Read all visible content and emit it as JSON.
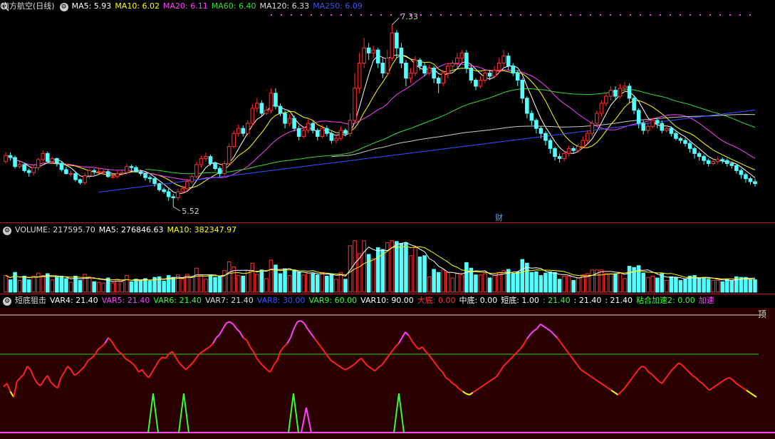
{
  "price": {
    "title": "南方航空(日线)",
    "ma": [
      {
        "label": "MA5: 5.93",
        "color": "#ffffff"
      },
      {
        "label": "MA10: 6.02",
        "color": "#ffff00"
      },
      {
        "label": "MA20: 6.11",
        "color": "#ff40ff"
      },
      {
        "label": "MA60: 6.40",
        "color": "#33dd33"
      },
      {
        "label": "MA120: 6.33",
        "color": "#dddddd"
      },
      {
        "label": "MA250: 6.09",
        "color": "#3355ff"
      }
    ],
    "high_label": "7.33",
    "low_label": "5.52",
    "marker": "财",
    "candles": [
      [
        5.97,
        6.03,
        5.95,
        6.06
      ],
      [
        6.03,
        6.01,
        5.98,
        6.06
      ],
      [
        6.01,
        5.92,
        5.9,
        6.03
      ],
      [
        5.92,
        5.94,
        5.9,
        5.97
      ],
      [
        5.94,
        5.88,
        5.86,
        5.96
      ],
      [
        5.88,
        5.86,
        5.82,
        5.9
      ],
      [
        5.86,
        5.91,
        5.83,
        5.94
      ],
      [
        5.91,
        5.99,
        5.88,
        6.01
      ],
      [
        5.99,
        6.05,
        5.97,
        6.08
      ],
      [
        6.05,
        5.97,
        5.95,
        6.07
      ],
      [
        5.97,
        6.0,
        5.95,
        6.02
      ],
      [
        6.0,
        5.95,
        5.92,
        6.01
      ],
      [
        5.95,
        5.89,
        5.87,
        5.97
      ],
      [
        5.89,
        5.85,
        5.84,
        5.92
      ],
      [
        5.85,
        5.85,
        5.82,
        5.88
      ],
      [
        5.85,
        5.79,
        5.77,
        5.87
      ],
      [
        5.79,
        5.76,
        5.74,
        5.8
      ],
      [
        5.76,
        5.83,
        5.74,
        5.86
      ],
      [
        5.83,
        5.88,
        5.8,
        5.9
      ],
      [
        5.88,
        5.87,
        5.84,
        5.9
      ],
      [
        5.87,
        5.87,
        5.85,
        5.91
      ],
      [
        5.87,
        5.87,
        5.84,
        5.89
      ],
      [
        5.87,
        5.82,
        5.81,
        5.89
      ],
      [
        5.82,
        5.82,
        5.8,
        5.85
      ],
      [
        5.82,
        5.85,
        5.8,
        5.88
      ],
      [
        5.85,
        5.86,
        5.83,
        5.89
      ],
      [
        5.86,
        5.92,
        5.84,
        5.95
      ],
      [
        5.92,
        5.91,
        5.88,
        5.94
      ],
      [
        5.91,
        5.87,
        5.86,
        5.93
      ],
      [
        5.87,
        5.85,
        5.83,
        5.89
      ],
      [
        5.85,
        5.81,
        5.78,
        5.86
      ],
      [
        5.81,
        5.8,
        5.76,
        5.83
      ],
      [
        5.8,
        5.75,
        5.72,
        5.81
      ],
      [
        5.75,
        5.69,
        5.67,
        5.76
      ],
      [
        5.69,
        5.67,
        5.65,
        5.71
      ],
      [
        5.67,
        5.62,
        5.58,
        5.7
      ],
      [
        5.62,
        5.61,
        5.52,
        5.65
      ],
      [
        5.61,
        5.67,
        5.58,
        5.7
      ],
      [
        5.67,
        5.7,
        5.65,
        5.73
      ],
      [
        5.7,
        5.77,
        5.68,
        5.8
      ],
      [
        5.77,
        5.82,
        5.75,
        5.84
      ],
      [
        5.82,
        5.94,
        5.8,
        5.97
      ],
      [
        5.94,
        6.0,
        5.91,
        6.03
      ],
      [
        6.0,
        6.02,
        5.97,
        6.06
      ],
      [
        6.02,
        5.95,
        5.93,
        6.04
      ],
      [
        5.95,
        5.9,
        5.88,
        5.97
      ],
      [
        5.9,
        5.85,
        5.82,
        5.92
      ],
      [
        5.85,
        5.95,
        5.83,
        5.98
      ],
      [
        5.95,
        6.12,
        5.93,
        6.15
      ],
      [
        6.12,
        6.25,
        6.1,
        6.28
      ],
      [
        6.25,
        6.3,
        6.22,
        6.34
      ],
      [
        6.3,
        6.25,
        6.22,
        6.33
      ],
      [
        6.25,
        6.35,
        6.23,
        6.38
      ],
      [
        6.35,
        6.5,
        6.32,
        6.54
      ],
      [
        6.5,
        6.55,
        6.46,
        6.6
      ],
      [
        6.55,
        6.45,
        6.42,
        6.58
      ],
      [
        6.45,
        6.48,
        6.43,
        6.52
      ],
      [
        6.48,
        6.65,
        6.45,
        6.7
      ],
      [
        6.65,
        6.52,
        6.49,
        6.7
      ],
      [
        6.52,
        6.45,
        6.42,
        6.55
      ],
      [
        6.45,
        6.35,
        6.3,
        6.48
      ],
      [
        6.35,
        6.4,
        6.32,
        6.44
      ],
      [
        6.4,
        6.3,
        6.27,
        6.43
      ],
      [
        6.3,
        6.22,
        6.18,
        6.33
      ],
      [
        6.22,
        6.28,
        6.2,
        6.32
      ],
      [
        6.28,
        6.35,
        6.25,
        6.39
      ],
      [
        6.35,
        6.28,
        6.25,
        6.38
      ],
      [
        6.28,
        6.22,
        6.18,
        6.3
      ],
      [
        6.22,
        6.3,
        6.2,
        6.34
      ],
      [
        6.3,
        6.25,
        6.22,
        6.33
      ],
      [
        6.25,
        6.18,
        6.15,
        6.27
      ],
      [
        6.18,
        6.2,
        6.15,
        6.24
      ],
      [
        6.2,
        6.28,
        6.18,
        6.32
      ],
      [
        6.28,
        6.25,
        6.22,
        6.3
      ],
      [
        6.25,
        6.38,
        6.22,
        6.45
      ],
      [
        6.38,
        6.7,
        6.35,
        6.85
      ],
      [
        6.7,
        6.95,
        6.65,
        7.05
      ],
      [
        6.95,
        7.1,
        6.9,
        7.2
      ],
      [
        7.1,
        7.05,
        6.98,
        7.15
      ],
      [
        7.05,
        7.08,
        7.0,
        7.12
      ],
      [
        7.08,
        6.95,
        6.9,
        7.1
      ],
      [
        6.95,
        6.85,
        6.8,
        7.0
      ],
      [
        6.85,
        7.0,
        6.82,
        7.08
      ],
      [
        7.0,
        7.25,
        6.97,
        7.33
      ],
      [
        7.25,
        7.1,
        7.0,
        7.28
      ],
      [
        7.1,
        6.95,
        6.9,
        7.15
      ],
      [
        6.95,
        6.8,
        6.72,
        6.98
      ],
      [
        6.8,
        6.85,
        6.75,
        6.9
      ],
      [
        6.85,
        6.98,
        6.82,
        7.02
      ],
      [
        6.98,
        6.92,
        6.88,
        7.0
      ],
      [
        6.92,
        6.85,
        6.82,
        6.95
      ],
      [
        6.85,
        6.9,
        6.83,
        6.93
      ],
      [
        6.9,
        6.8,
        6.75,
        6.92
      ],
      [
        6.8,
        6.75,
        6.65,
        6.82
      ],
      [
        6.75,
        6.85,
        6.72,
        6.88
      ],
      [
        6.85,
        6.92,
        6.8,
        6.95
      ],
      [
        6.92,
        6.95,
        6.88,
        6.98
      ],
      [
        6.95,
        7.0,
        6.9,
        7.05
      ],
      [
        7.0,
        7.05,
        6.95,
        7.08
      ],
      [
        7.05,
        6.9,
        6.85,
        7.08
      ],
      [
        6.9,
        6.78,
        6.75,
        6.92
      ],
      [
        6.78,
        6.72,
        6.68,
        6.8
      ],
      [
        6.72,
        6.78,
        6.7,
        6.82
      ],
      [
        6.78,
        6.85,
        6.75,
        6.88
      ],
      [
        6.85,
        6.82,
        6.78,
        6.88
      ],
      [
        6.82,
        6.88,
        6.8,
        6.92
      ],
      [
        6.88,
        6.95,
        6.85,
        7.0
      ],
      [
        6.95,
        7.02,
        6.9,
        7.08
      ],
      [
        7.02,
        6.92,
        6.88,
        7.05
      ],
      [
        6.92,
        6.85,
        6.82,
        6.95
      ],
      [
        6.85,
        6.78,
        6.72,
        6.88
      ],
      [
        6.78,
        6.6,
        6.55,
        6.8
      ],
      [
        6.6,
        6.45,
        6.4,
        6.62
      ],
      [
        6.45,
        6.38,
        6.33,
        6.48
      ],
      [
        6.38,
        6.3,
        6.25,
        6.4
      ],
      [
        6.3,
        6.25,
        6.2,
        6.32
      ],
      [
        6.25,
        6.18,
        6.13,
        6.27
      ],
      [
        6.18,
        6.1,
        6.05,
        6.2
      ],
      [
        6.1,
        6.02,
        5.98,
        6.12
      ],
      [
        6.02,
        6.0,
        5.96,
        6.05
      ],
      [
        6.0,
        6.05,
        5.97,
        6.08
      ],
      [
        6.05,
        6.1,
        6.02,
        6.13
      ],
      [
        6.1,
        6.08,
        6.05,
        6.12
      ],
      [
        6.08,
        6.12,
        6.06,
        6.15
      ],
      [
        6.12,
        6.18,
        6.1,
        6.22
      ],
      [
        6.18,
        6.25,
        6.15,
        6.28
      ],
      [
        6.25,
        6.35,
        6.22,
        6.38
      ],
      [
        6.35,
        6.45,
        6.32,
        6.48
      ],
      [
        6.45,
        6.55,
        6.42,
        6.58
      ],
      [
        6.55,
        6.62,
        6.52,
        6.65
      ],
      [
        6.62,
        6.68,
        6.58,
        6.72
      ],
      [
        6.68,
        6.62,
        6.58,
        6.72
      ],
      [
        6.62,
        6.7,
        6.6,
        6.74
      ],
      [
        6.7,
        6.72,
        6.66,
        6.76
      ],
      [
        6.72,
        6.6,
        6.55,
        6.75
      ],
      [
        6.6,
        6.48,
        6.44,
        6.62
      ],
      [
        6.48,
        6.35,
        6.3,
        6.5
      ],
      [
        6.35,
        6.28,
        6.24,
        6.38
      ],
      [
        6.28,
        6.32,
        6.25,
        6.35
      ],
      [
        6.32,
        6.38,
        6.3,
        6.4
      ],
      [
        6.38,
        6.35,
        6.3,
        6.4
      ],
      [
        6.35,
        6.28,
        6.25,
        6.38
      ],
      [
        6.28,
        6.3,
        6.26,
        6.33
      ],
      [
        6.3,
        6.25,
        6.22,
        6.32
      ],
      [
        6.25,
        6.2,
        6.18,
        6.27
      ],
      [
        6.2,
        6.18,
        6.15,
        6.22
      ],
      [
        6.18,
        6.15,
        6.12,
        6.2
      ],
      [
        6.15,
        6.1,
        6.06,
        6.17
      ],
      [
        6.1,
        6.05,
        6.0,
        6.12
      ],
      [
        6.05,
        6.02,
        5.98,
        6.07
      ],
      [
        6.02,
        5.98,
        5.94,
        6.04
      ],
      [
        5.98,
        5.95,
        5.92,
        6.0
      ],
      [
        5.95,
        5.97,
        5.93,
        6.0
      ],
      [
        5.97,
        5.99,
        5.95,
        6.02
      ],
      [
        5.99,
        5.98,
        5.95,
        6.01
      ],
      [
        5.98,
        5.95,
        5.92,
        6.0
      ],
      [
        5.95,
        5.93,
        5.9,
        5.97
      ],
      [
        5.93,
        5.88,
        5.85,
        5.95
      ],
      [
        5.88,
        5.84,
        5.8,
        5.9
      ],
      [
        5.84,
        5.8,
        5.76,
        5.86
      ],
      [
        5.8,
        5.77,
        5.74,
        5.82
      ],
      [
        5.77,
        5.75,
        5.72,
        5.8
      ]
    ]
  },
  "volume": {
    "label": "VOLUME: 217595.70",
    "ma5": "MA5: 276846.63",
    "ma10": "MA10: 382347.97"
  },
  "indicator": {
    "name": "短底狙击",
    "vars": [
      {
        "label": "VAR4: 21.40",
        "color": "#ffffff"
      },
      {
        "label": "VAR5: 21.40",
        "color": "#ff40ff"
      },
      {
        "label": "VAR6: 21.40",
        "color": "#33ff33"
      },
      {
        "label": "VAR7: 21.40",
        "color": "#dddddd"
      },
      {
        "label": "VAR8: 30.00",
        "color": "#3355ff"
      },
      {
        "label": "VAR9: 60.00",
        "color": "#33ff33"
      },
      {
        "label": "VAR10: 90.00",
        "color": "#ffffff"
      },
      {
        "label": "大底: 0.00",
        "color": "#ff3333"
      },
      {
        "label": "中底: 0.00",
        "color": "#ffffff"
      },
      {
        "label": "短底: 1.00",
        "color": "#ffffff"
      },
      {
        "label": ": 21.40",
        "color": "#33ff33"
      },
      {
        "label": ": 21.40",
        "color": "#ffffff"
      },
      {
        "label": ": 21.40",
        "color": "#ffffff"
      },
      {
        "label": "粘合加速2: 0.00",
        "color": "#33ff33"
      },
      {
        "label": "加速",
        "color": "#ff40ff"
      }
    ],
    "top_label": "顶",
    "values": [
      37,
      40,
      33,
      28,
      42,
      45,
      48,
      55,
      52,
      45,
      40,
      38,
      43,
      47,
      41,
      38,
      36,
      45,
      50,
      55,
      52,
      47,
      49,
      52,
      55,
      60,
      62,
      65,
      70,
      72,
      75,
      80,
      77,
      72,
      68,
      66,
      62,
      60,
      58,
      55,
      50,
      52,
      48,
      45,
      50,
      55,
      60,
      63,
      62,
      66,
      68,
      63,
      58,
      55,
      52,
      55,
      58,
      62,
      66,
      68,
      70,
      72,
      75,
      80,
      83,
      88,
      93,
      94,
      92,
      88,
      85,
      80,
      78,
      72,
      68,
      62,
      58,
      55,
      52,
      50,
      56,
      60,
      68,
      72,
      75,
      80,
      88,
      94,
      95,
      93,
      88,
      84,
      80,
      76,
      72,
      68,
      64,
      60,
      58,
      56,
      54,
      52,
      53,
      55,
      57,
      60,
      62,
      58,
      55,
      53,
      51,
      54,
      56,
      60,
      64,
      68,
      72,
      75,
      80,
      85,
      82,
      77,
      73,
      70,
      72,
      68,
      65,
      61,
      57,
      53,
      50,
      45,
      43,
      40,
      38,
      35,
      33,
      31,
      30,
      32,
      34,
      36,
      38,
      40,
      42,
      44,
      46,
      50,
      55,
      58,
      61,
      64,
      67,
      70,
      74,
      79,
      83,
      86,
      88,
      92,
      90,
      88,
      86,
      83,
      80,
      76,
      72,
      68,
      64,
      60,
      56,
      52,
      50,
      48,
      46,
      44,
      42,
      40,
      38,
      36,
      34,
      32,
      30,
      33,
      36,
      40,
      44,
      48,
      52,
      55,
      54,
      50,
      48,
      45,
      42,
      40,
      44,
      48,
      52,
      55,
      58,
      56,
      53,
      50,
      47,
      45,
      42,
      40,
      37,
      34,
      36,
      38,
      40,
      42,
      44,
      45,
      43,
      40,
      38,
      36,
      34,
      32,
      30,
      28
    ]
  }
}
